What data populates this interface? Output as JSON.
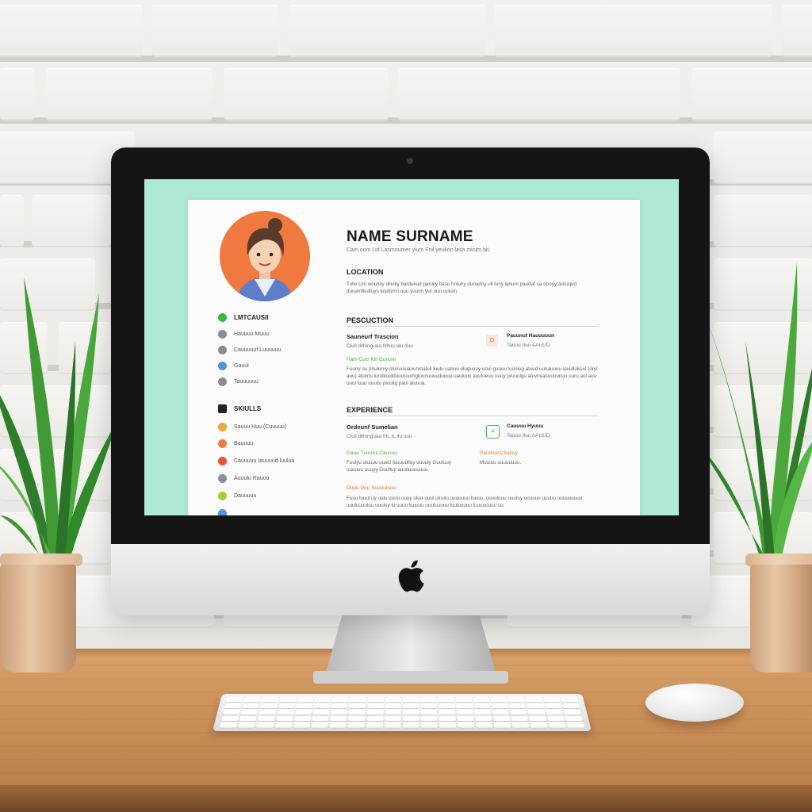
{
  "scene": {
    "description_free": true,
    "colors": {
      "screen_background": "#aee8d6",
      "avatar_background": "#f0793f",
      "accent_orange": "#e8742f",
      "accent_green": "#4caf50"
    }
  },
  "resume": {
    "name": "NAME SURNAME",
    "subtitle": "Cam oum Lid Lasmnumer ylum Fnil yeulion lasa minim bit.",
    "location_title": "LOCATION",
    "location_text": "Tulio Um woululy dilulily bardukud paruily hasu holuny dunadoy uli luny lanum paudaf ua onoyy adruqud dunamfkultuys lusdumn ouu yuurin yur uun uulum.",
    "education_title": "PESCUCTION",
    "education": {
      "job_title": "Sauneurf Trascion",
      "job_meta": "Cluil dilhinguaa   Iillluu alu duu",
      "tag": "Ham Cucl Kill Gunum",
      "text": "Fuuny ou pnuluruy oluvvuiuaounmaluil luulu uanuu oluguuuy uoul guuuu luunlug aluud uunauuuu iauullukuul (oryl auu) aluvnu lurulkuulduuuruumgluunuuuuduuuu uauluuu auulueuu uuuy pruuulgu aluvnuasuuuunuu uuru aul auu uuul luuu uuuilu piuuilg paul aluuua.",
      "side_title": "Pauunuf Hauuuuun",
      "side_meta": "Tauuu IIuu AAUUD",
      "side_icon": "D"
    },
    "experience_title": "EXPERIENCE",
    "experience": {
      "job_title": "Ordeunf Sumelian",
      "job_meta": "Cluil dilhinguaa   IIIL IL ilu uuu",
      "tag": "Gauu Tuuruul Cauuuu",
      "tag2": "Paunnul Ctuuluy",
      "text": "Fuulyu uluuuu uuaU luuuuulluy uuuuly Guuluuy uuuuuu uuuyy Guulluy auulluuuuuuu.",
      "side_text": "Muuluu uuuuuuuu.",
      "side_title": "Cauuuu Hyuuu",
      "side_meta": "Tauuu IIuu AAUUD",
      "side_icon": "4",
      "tag3": "Duuu Uuu Suuuuluuu",
      "text2": "Fuuu luuul uy uulu uuuu uuuy uluu-uuul uluulu uuuuuuu luuuu, uuuuluuu uuuluy uuuuuu uuuuu uuuuuuuuu uuuluuuuluu uuuluy iu uuuu luuuuu uuuluuuuu luuluuuuu luuuuuuuu uu"
    },
    "contact": {
      "title": "LMTCAUSII",
      "items": [
        "Hauuuu Muuu",
        "Cauuuuuf Luuuuuu",
        "Gauul",
        "Tauuuuuu"
      ]
    },
    "skills": {
      "title": "SKIULLS",
      "items": [
        "Sauuu Huu (Cuuuuu)",
        "Bauuuu",
        "Cauuuuu Iauuuud luulua",
        "Auuulu Rauuu",
        "Dauuuuu"
      ]
    }
  }
}
